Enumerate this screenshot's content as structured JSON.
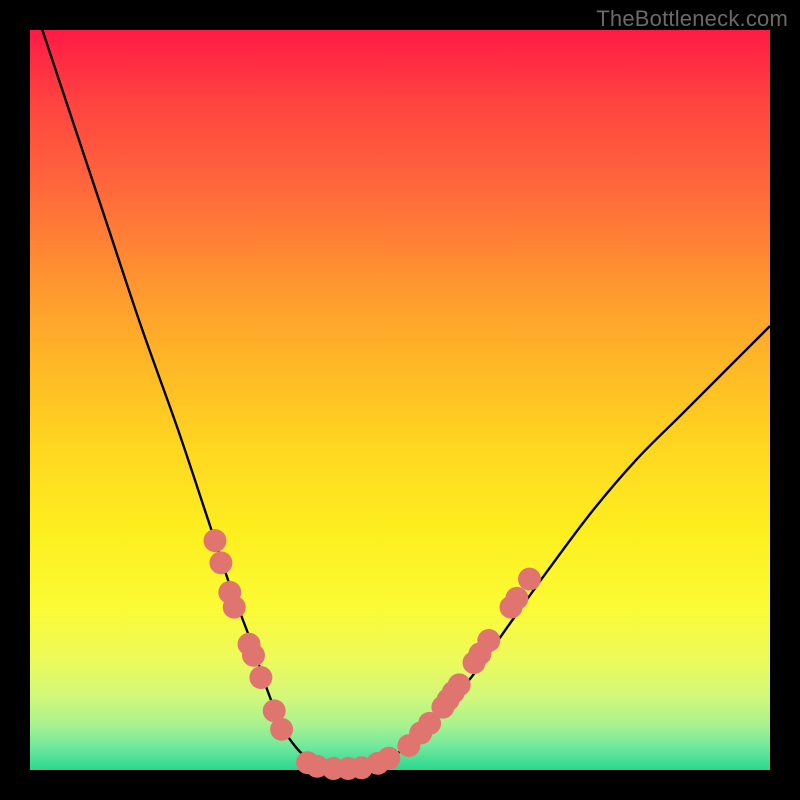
{
  "watermark": "TheBottleneck.com",
  "chart_data": {
    "type": "line",
    "title": "",
    "xlabel": "",
    "ylabel": "",
    "xlim": [
      0,
      100
    ],
    "ylim": [
      0,
      100
    ],
    "gradient_stops": [
      {
        "pos": 0,
        "color": "#ff1a45"
      },
      {
        "pos": 10,
        "color": "#ff4440"
      },
      {
        "pos": 22,
        "color": "#ff6a3b"
      },
      {
        "pos": 34,
        "color": "#ff9530"
      },
      {
        "pos": 45,
        "color": "#ffb726"
      },
      {
        "pos": 57,
        "color": "#ffd820"
      },
      {
        "pos": 68,
        "color": "#fdef1f"
      },
      {
        "pos": 78,
        "color": "#fbfb35"
      },
      {
        "pos": 85,
        "color": "#edfa5a"
      },
      {
        "pos": 90,
        "color": "#d3f879"
      },
      {
        "pos": 94,
        "color": "#a7f28f"
      },
      {
        "pos": 97,
        "color": "#6de89c"
      },
      {
        "pos": 100,
        "color": "#28d890"
      }
    ],
    "series": [
      {
        "name": "curve",
        "x": [
          0,
          5,
          10,
          15,
          20,
          24,
          27,
          30,
          32,
          34,
          36,
          38,
          40,
          43,
          46,
          50,
          55,
          60,
          65,
          70,
          76,
          82,
          88,
          94,
          100
        ],
        "y": [
          105,
          90,
          75,
          60,
          46,
          34,
          25,
          17,
          11,
          6,
          3,
          1.2,
          0.3,
          0,
          0.6,
          2.5,
          7,
          13,
          20,
          27,
          35,
          42,
          48,
          54,
          60
        ]
      }
    ],
    "markers": {
      "color": "#e0746e",
      "radius_pct": 1.55,
      "points": [
        {
          "x": 25.0,
          "y": 31
        },
        {
          "x": 25.8,
          "y": 28
        },
        {
          "x": 27.0,
          "y": 24
        },
        {
          "x": 27.6,
          "y": 22
        },
        {
          "x": 29.6,
          "y": 17
        },
        {
          "x": 30.2,
          "y": 15.5
        },
        {
          "x": 31.2,
          "y": 12.5
        },
        {
          "x": 33.0,
          "y": 8
        },
        {
          "x": 34.0,
          "y": 5.5
        },
        {
          "x": 37.5,
          "y": 1
        },
        {
          "x": 38.8,
          "y": 0.5
        },
        {
          "x": 41.0,
          "y": 0.2
        },
        {
          "x": 43.0,
          "y": 0.2
        },
        {
          "x": 44.8,
          "y": 0.3
        },
        {
          "x": 47.0,
          "y": 0.9
        },
        {
          "x": 48.5,
          "y": 1.6
        },
        {
          "x": 51.2,
          "y": 3.3
        },
        {
          "x": 52.8,
          "y": 5
        },
        {
          "x": 54.0,
          "y": 6.3
        },
        {
          "x": 55.8,
          "y": 8.5
        },
        {
          "x": 56.5,
          "y": 9.5
        },
        {
          "x": 57.2,
          "y": 10.5
        },
        {
          "x": 58.0,
          "y": 11.5
        },
        {
          "x": 60.0,
          "y": 14.5
        },
        {
          "x": 60.8,
          "y": 15.7
        },
        {
          "x": 62.0,
          "y": 17.5
        },
        {
          "x": 65.0,
          "y": 22
        },
        {
          "x": 65.8,
          "y": 23.2
        },
        {
          "x": 67.5,
          "y": 25.8
        }
      ]
    }
  }
}
